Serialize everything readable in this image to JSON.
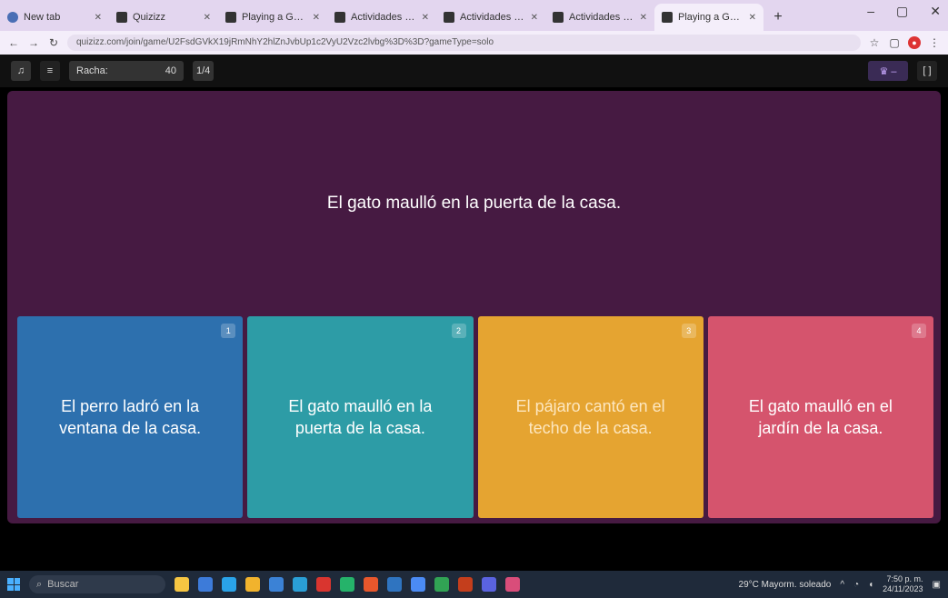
{
  "browser": {
    "tabs": [
      {
        "title": "New tab",
        "active": false
      },
      {
        "title": "Quizizz",
        "active": false
      },
      {
        "title": "Playing a Game - Quizizz",
        "active": false
      },
      {
        "title": "Actividades con Oracio",
        "active": false
      },
      {
        "title": "Actividades con Oracio",
        "active": false
      },
      {
        "title": "Actividades con Oracio",
        "active": false
      },
      {
        "title": "Playing a Game - Q",
        "active": true
      }
    ],
    "new_tab_label": "+",
    "window_controls": [
      "–",
      "▢",
      "✕"
    ],
    "nav": [
      "←",
      "→",
      "↻"
    ],
    "url": "quizizz.com/join/game/U2FsdGVkX19jRmNhY2hlZnJvbUp1c2VyU2Vzc2lvbg%3D%3D?gameType=solo"
  },
  "game_bar": {
    "music_icon": "♫",
    "streak_label": "Racha:",
    "streak_value": "40",
    "question_counter": "1/4",
    "theme_label": "♛ –",
    "fullscreen_label": "[ ]"
  },
  "question": {
    "text": "El gato maulló en la puerta de la casa."
  },
  "options": [
    {
      "number": "1",
      "text": "El perro ladró en la ventana de la casa."
    },
    {
      "number": "2",
      "text": "El gato maulló en la puerta de la casa."
    },
    {
      "number": "3",
      "text": "El pájaro cantó en el techo de la casa."
    },
    {
      "number": "4",
      "text": "El gato maulló en el jardín de la casa."
    }
  ],
  "taskbar": {
    "search_placeholder": "Buscar",
    "weather": "29°C Mayorm. soleado",
    "time": "7:50 p. m.",
    "date": "24/11/2023"
  },
  "colors": {
    "question_bg": "#461a42",
    "option_1": "#2d70ae",
    "option_2": "#2d9ca6",
    "option_3": "#e5a431",
    "option_4": "#d5546d"
  }
}
